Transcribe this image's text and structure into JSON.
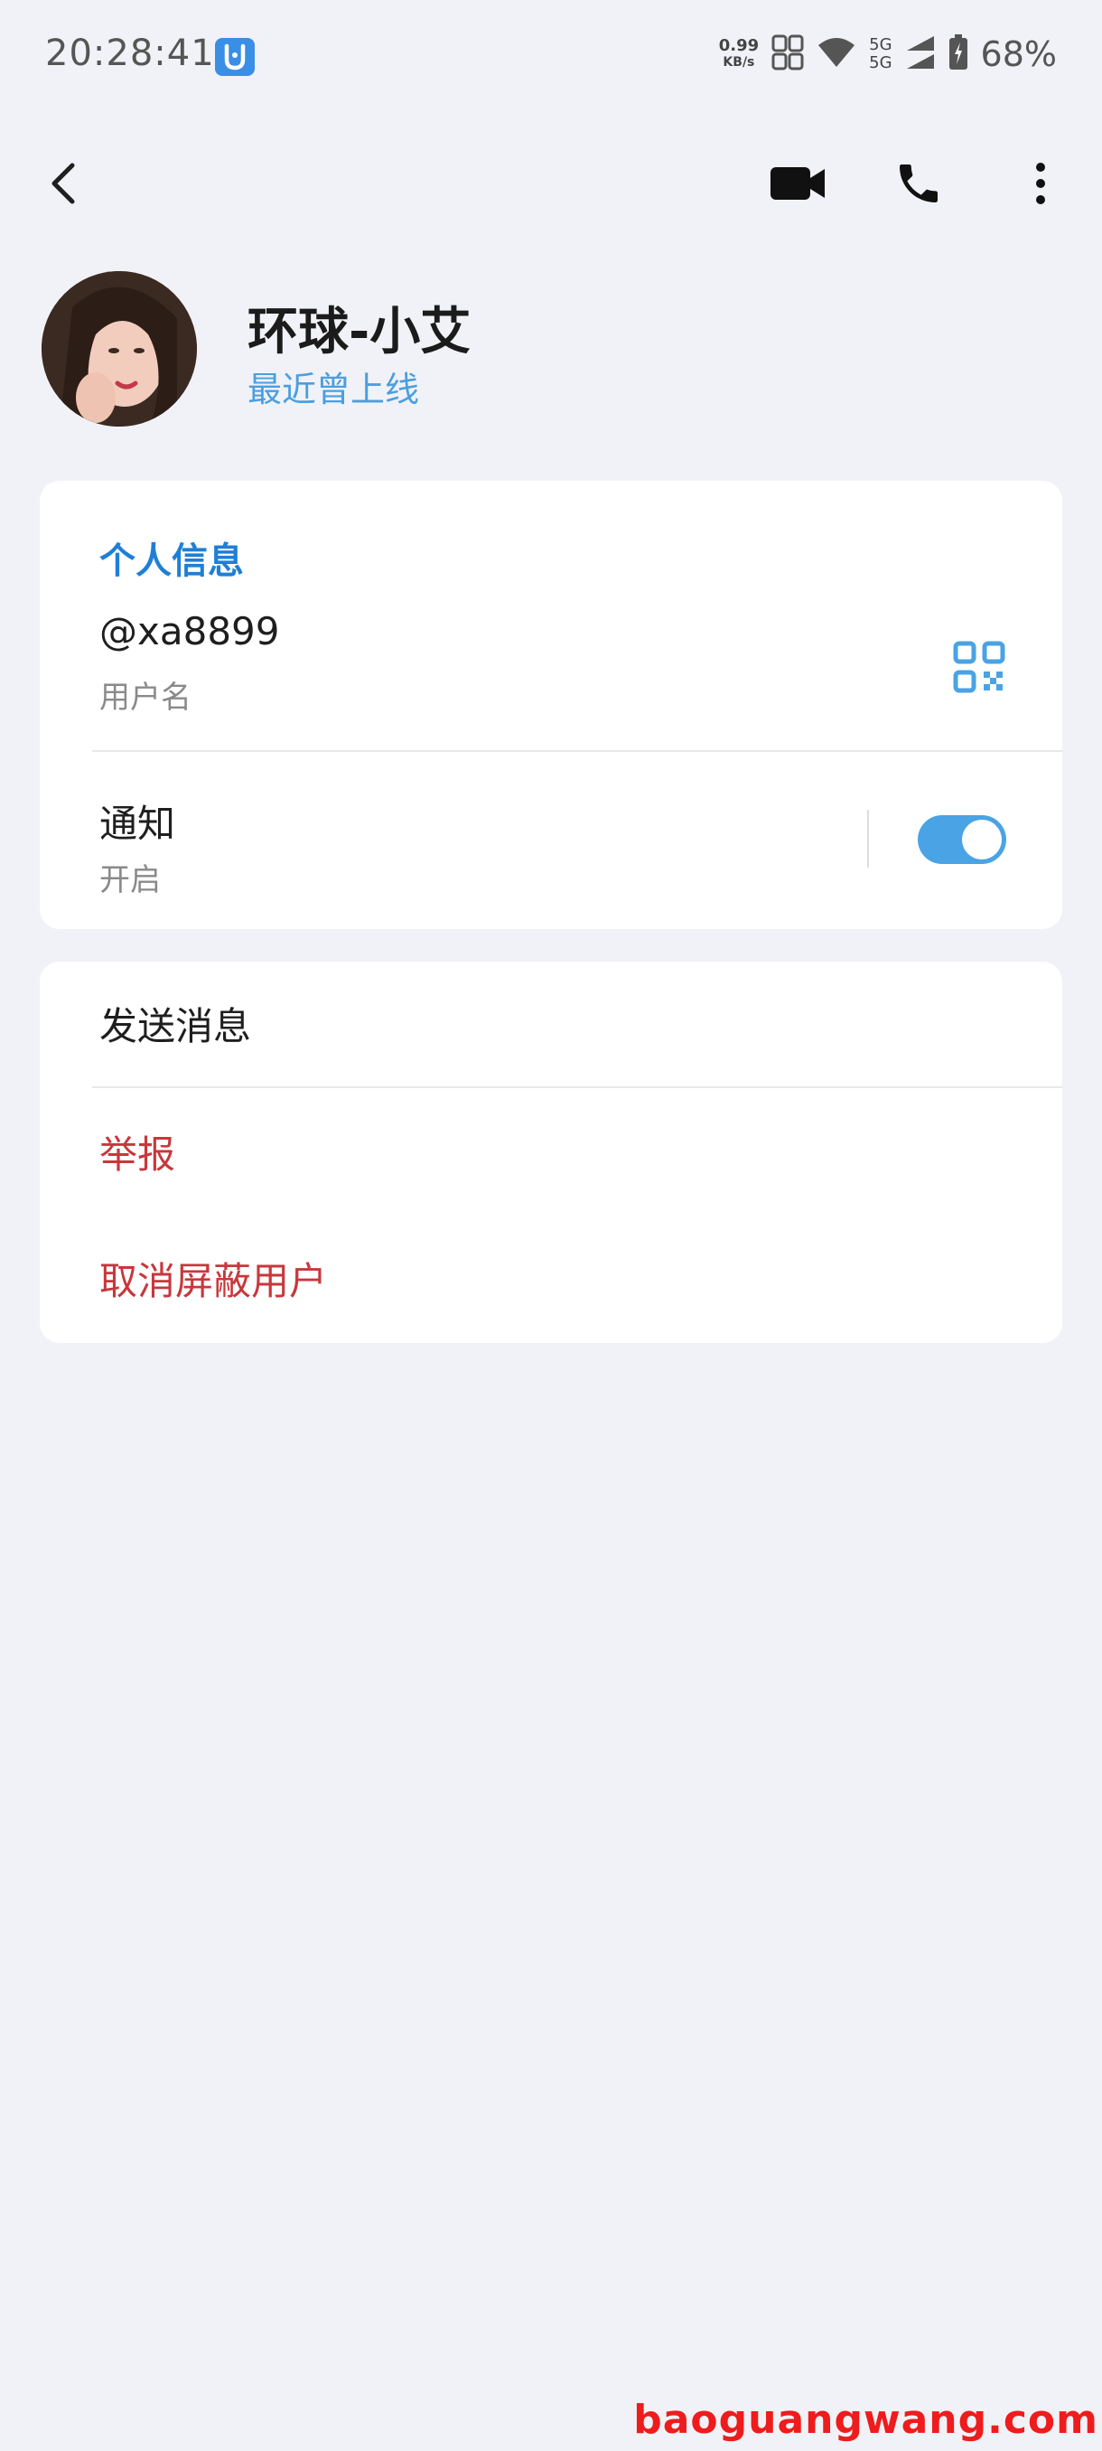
{
  "status_bar": {
    "time": "20:28:41",
    "app_icon": "u-shield-icon",
    "net_speed_value": "0.99",
    "net_speed_unit": "KB/s",
    "network_top": "5G",
    "network_bottom": "5G",
    "battery_percent": "68%"
  },
  "nav": {
    "back_icon": "chevron-left-icon",
    "video_icon": "video-camera-icon",
    "call_icon": "phone-icon",
    "more_icon": "more-vertical-icon"
  },
  "profile": {
    "name": "环球-小艾",
    "status": "最近曾上线"
  },
  "info_card": {
    "section_title": "个人信息",
    "username": "@xa8899",
    "username_label": "用户名",
    "notifications_label": "通知",
    "notifications_state": "开启",
    "notifications_on": true
  },
  "actions": {
    "send_message": "发送消息",
    "report": "举报",
    "unblock_user": "取消屏蔽用户"
  },
  "watermark": "baoguangwang.com",
  "colors": {
    "accent": "#1e7fd6",
    "status_text": "#4a9fe0",
    "danger": "#c8373b",
    "background": "#f1f2f7",
    "toggle_on": "#4aa3e4"
  }
}
